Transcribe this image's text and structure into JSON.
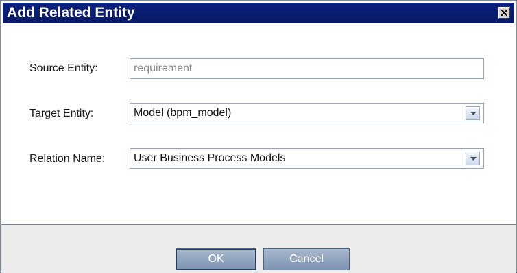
{
  "dialog": {
    "title": "Add Related Entity",
    "close_icon": "close-icon"
  },
  "form": {
    "source_label": "Source Entity:",
    "source_value": "requirement",
    "target_label": "Target Entity:",
    "target_value": "Model (bpm_model)",
    "relation_label": "Relation Name:",
    "relation_value": "User Business Process Models"
  },
  "buttons": {
    "ok": "OK",
    "cancel": "Cancel"
  },
  "colors": {
    "titlebar": "#0a1e6e",
    "button": "#8ea2bd"
  }
}
